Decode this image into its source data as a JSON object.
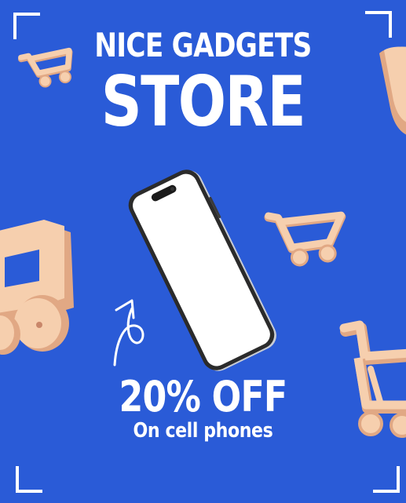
{
  "poster": {
    "title_line1": "NICE GADGETS",
    "title_line2": "STORE",
    "discount": "20% OFF",
    "subtext": "On cell phones"
  },
  "colors": {
    "background": "#2a5bd7",
    "text": "#ffffff",
    "cart": "#f6cfae",
    "cart_shadow": "#e1a884",
    "phone_frame": "#2b2b2b",
    "phone_screen": "#ffffff"
  },
  "icons": [
    "shopping-cart-icon",
    "smartphone-icon",
    "curved-arrow-icon",
    "corner-bracket-icon"
  ]
}
